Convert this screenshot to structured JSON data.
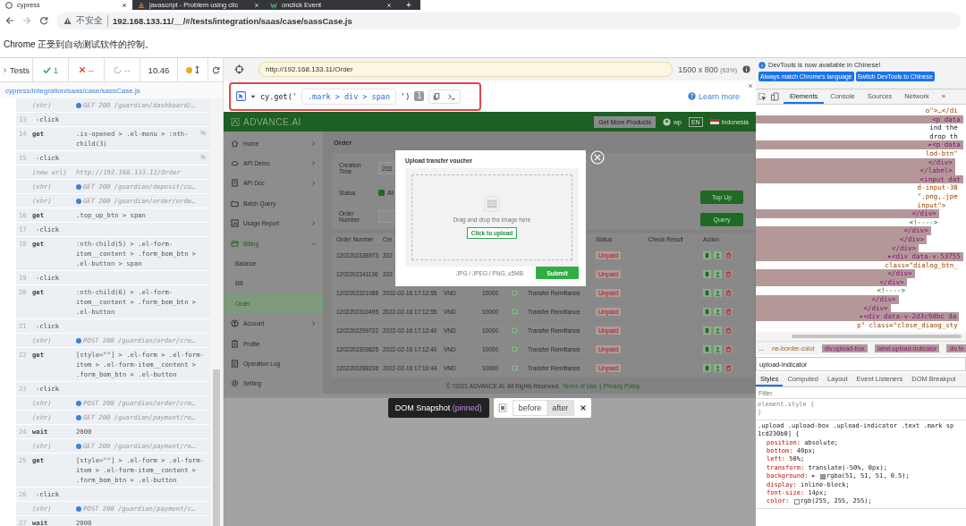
{
  "browser_tabs": [
    {
      "title": "cypress",
      "selected": true
    },
    {
      "title": "javascript - Problem using clic",
      "selected": false
    },
    {
      "title": "onclick Event",
      "selected": false
    }
  ],
  "new_tab": "+",
  "address_bar": {
    "security": "不安全",
    "url": "192.168.133.11/__/#/tests/integration/saas/case/sassCase.js"
  },
  "automation_notice": "Chrome 正受到自动测试软件的控制。",
  "runner": {
    "tests_label": "Tests",
    "passed": "1",
    "failed": "--",
    "pending": "--",
    "duration": "10.46",
    "spec_path": "cypress/integration/saas/case/sassCase.js",
    "log": [
      {
        "kind": "xhr",
        "label": "(xhr)",
        "text": "GET 200 /guardian/dashboard/…"
      },
      {
        "kind": "command",
        "number": "13",
        "name": "-click",
        "hidden": false
      },
      {
        "kind": "command",
        "number": "14",
        "name": "get",
        "message": ".is-opened > .el-menu > :nth-child(3)",
        "hidden": true
      },
      {
        "kind": "command",
        "number": "15",
        "name": "-click",
        "hidden": true
      },
      {
        "kind": "url",
        "label": "(new url)",
        "text": "http://192.168.133.11/Order"
      },
      {
        "kind": "xhr",
        "label": "(xhr)",
        "text": "GET 200 /guardian/deposit/cu…"
      },
      {
        "kind": "xhr",
        "label": "(xhr)",
        "text": "GET 200 /guardian/order/orde…"
      },
      {
        "kind": "command",
        "number": "16",
        "name": "get",
        "message": ".top_up_btn > span",
        "hidden": false
      },
      {
        "kind": "command",
        "number": "17",
        "name": "-click",
        "hidden": false
      },
      {
        "kind": "command",
        "number": "18",
        "name": "get",
        "message": ":nth-child(5) > .el-form-item__content > .form_bom_btn > .el-button > span",
        "hidden": false
      },
      {
        "kind": "command",
        "number": "19",
        "name": "-click",
        "hidden": false
      },
      {
        "kind": "command",
        "number": "20",
        "name": "get",
        "message": ":nth-child(6) > .el-form-item__content > .form_bom_btn > .el-button",
        "hidden": false
      },
      {
        "kind": "command",
        "number": "21",
        "name": "-click",
        "hidden": false
      },
      {
        "kind": "xhr",
        "label": "(xhr)",
        "text": "POST 200 /guardian/order/cre…"
      },
      {
        "kind": "command",
        "number": "22",
        "name": "get",
        "message": "[style=\"\"] > .el-form > .el-form-item > .el-form-item__content > .form_bom_btn > .el-button",
        "hidden": false
      },
      {
        "kind": "command",
        "number": "23",
        "name": "-click",
        "hidden": false
      },
      {
        "kind": "xhr",
        "label": "(xhr)",
        "text": "POST 200 /guardian/order/cre…"
      },
      {
        "kind": "xhr",
        "label": "(xhr)",
        "text": "GET 200 /guardian/payment/re…"
      },
      {
        "kind": "command",
        "number": "24",
        "name": "wait",
        "message": "2000",
        "hidden": false
      },
      {
        "kind": "xhr",
        "label": "(xhr)",
        "text": "GET 200 /guardian/payment/re…"
      },
      {
        "kind": "command",
        "number": "25",
        "name": "get",
        "message": "[style=\"\"] > .el-form > .el-form-item > .el-form-item__content > .form_bom_btn > .el-button",
        "hidden": false
      },
      {
        "kind": "command",
        "number": "26",
        "name": "-click",
        "hidden": false
      },
      {
        "kind": "xhr",
        "label": "(xhr)",
        "text": "POST 200 /guardian/payment/c…"
      },
      {
        "kind": "command",
        "number": "27",
        "name": "wait",
        "message": "2000",
        "hidden": false
      }
    ]
  },
  "preview": {
    "url": "http://192.168.133.11/Order",
    "viewport": "1500 x 800",
    "scale": "(63%)",
    "selector": {
      "prefix": "cy.get('",
      "value": ".mark > div > span",
      "suffix": "')",
      "matches": "1"
    },
    "learn_more": "Learn more"
  },
  "app": {
    "logo": "ADVANCE.AI",
    "header_button": "Get More Products",
    "user": "wp",
    "language": "EN",
    "region": "Indonesia",
    "sidebar": [
      {
        "kind": "group",
        "label": "Home",
        "expanded": false
      },
      {
        "kind": "group",
        "label": "API Demo",
        "expanded": false
      },
      {
        "kind": "group",
        "label": "API Doc",
        "expanded": false
      },
      {
        "kind": "link",
        "label": "Batch Query",
        "selected": false
      },
      {
        "kind": "group",
        "label": "Usage Report",
        "expanded": false
      },
      {
        "kind": "group",
        "label": "Billing",
        "expanded": true,
        "children": [
          {
            "label": "Balance",
            "selected": false
          },
          {
            "label": "Bill",
            "selected": false
          },
          {
            "label": "Order",
            "selected": true
          }
        ]
      },
      {
        "kind": "group",
        "label": "Account",
        "expanded": false
      },
      {
        "kind": "link",
        "label": "Profile",
        "selected": false
      },
      {
        "kind": "link",
        "label": "Operation Log",
        "selected": false
      },
      {
        "kind": "link",
        "label": "Setting",
        "selected": false
      }
    ],
    "page_title": "Order",
    "filters": {
      "creation_time_label": "Creation Time",
      "creation_time_value": "202",
      "status_label": "Status",
      "status_option": {
        "label": "All",
        "checked": true
      },
      "order_number_label": "Order Number"
    },
    "buttons": [
      "Top Up",
      "Query"
    ],
    "table": {
      "columns": [
        "Order Number",
        "Cre",
        "Status",
        "Check Result",
        "Action"
      ],
      "rows": [
        {
          "order_number": "1202202338973",
          "created": "202",
          "status": "Unpaid"
        },
        {
          "order_number": "1202202341136",
          "created": "202",
          "status": "Unpaid"
        },
        {
          "order_number": "1202202321088",
          "created": "2022-02-16 17:12:55",
          "currency": "VND",
          "amount": "10000",
          "method": "Transfer Remittance",
          "status": "Unpaid"
        },
        {
          "order_number": "1202202310495",
          "created": "2022-02-16 17:12:55",
          "currency": "VND",
          "amount": "10000",
          "method": "Transfer Remittance",
          "status": "Unpaid"
        },
        {
          "order_number": "1202202299722",
          "created": "2022-02-16 17:12:40",
          "currency": "VND",
          "amount": "10000",
          "method": "Transfer Remittance",
          "status": "Unpaid"
        },
        {
          "order_number": "1202202303825",
          "created": "2022-02-16 17:12:40",
          "currency": "VND",
          "amount": "10000",
          "method": "Transfer Remittance",
          "status": "Unpaid"
        },
        {
          "order_number": "1202202288236",
          "created": "2022-02-16 17:10:44",
          "currency": "VND",
          "amount": "10000",
          "method": "Transfer Remittance",
          "status": "Unpaid"
        }
      ]
    },
    "footer": {
      "text": "© ?2021 ADVANCE.AI. All Rights Reserved.",
      "links": [
        "Terms of Use",
        "Privacy Policy"
      ],
      "separator": "|"
    },
    "dialog": {
      "title": "Upload transfer voucher",
      "hint": "Drag and drop the image here",
      "upload_button": "Click to upload",
      "formats": "JPG / JPEG / PNG, ≤5MB",
      "submit": "Submit"
    }
  },
  "snapshot_bar": {
    "label": "DOM Snapshot",
    "note": "(pinned)",
    "states": [
      {
        "label": "before",
        "selected": false
      },
      {
        "label": "after",
        "selected": true
      }
    ]
  },
  "devtools": {
    "notice": "DevTools is now available in Chinese!",
    "notice_buttons": [
      "Always match Chrome's language",
      "Switch DevTools to Chinese"
    ],
    "tabs": [
      {
        "label": "Elements",
        "selected": true
      },
      {
        "label": "Console",
        "selected": false
      },
      {
        "label": "Sources",
        "selected": false
      },
      {
        "label": "Network",
        "selected": false
      }
    ],
    "more": "»",
    "dom_lines": [
      {
        "kind": "attr",
        "text": "                                          o\">…</di"
      },
      {
        "kind": "tag",
        "text": "                                           <p data"
      },
      {
        "kind": "text",
        "text": "                                           ind the"
      },
      {
        "kind": "text",
        "text": "                                           drop th"
      },
      {
        "kind": "tag",
        "text": "                                          ▸<p data"
      },
      {
        "kind": "attr",
        "text": "                                          lod-btn\""
      },
      {
        "kind": "tag",
        "text": "                                          </div>"
      },
      {
        "kind": "tag",
        "text": "                                        </label>"
      },
      {
        "kind": "tag",
        "text": "                                        <input dat"
      },
      {
        "kind": "attr",
        "text": "                                        d-input-38"
      },
      {
        "kind": "attr",
        "text": "                                        \".png,.jpe"
      },
      {
        "kind": "attr",
        "text": "                                        input\">"
      },
      {
        "kind": "tag",
        "text": "                                      </div>"
      },
      {
        "kind": "comment",
        "text": "                                      <!---->"
      },
      {
        "kind": "tag",
        "text": "                                    </div>"
      },
      {
        "kind": "tag",
        "text": "                                   </div>"
      },
      {
        "kind": "tag",
        "text": "                                 </div>"
      },
      {
        "kind": "tag",
        "text": "                                ▸<div data-v-53755"
      },
      {
        "kind": "attr",
        "text": "                                class=\"dialog_btn_"
      },
      {
        "kind": "tag",
        "text": "                                </div>"
      },
      {
        "kind": "tag",
        "text": "                              </div>"
      },
      {
        "kind": "comment",
        "text": "                              <!---->"
      },
      {
        "kind": "tag",
        "text": "                            </div>"
      },
      {
        "kind": "tag",
        "text": "                          </div>"
      },
      {
        "kind": "tag",
        "text": "                         ▸<div data-v-2d3c9dbc da"
      },
      {
        "kind": "attr",
        "text": "                         p\" class=\"close_diaog_sty"
      }
    ],
    "breadcrumb_more": "…",
    "breadcrumbs": [
      {
        "kind": "attr",
        "text": "ne-border-color"
      },
      {
        "kind": "tag",
        "text": "div.upload-box"
      },
      {
        "kind": "tag",
        "text": "label.upload-indicator"
      },
      {
        "kind": "tag",
        "text": "div.te"
      }
    ],
    "search_value": "upload-indicator",
    "style_tabs": [
      {
        "label": "Styles",
        "selected": true
      },
      {
        "label": "Computed",
        "selected": false
      },
      {
        "label": "Layout",
        "selected": false
      },
      {
        "label": "Event Listeners",
        "selected": false
      },
      {
        "label": "DOM Breakpoi",
        "selected": false
      }
    ],
    "filter_placeholder": "Filter",
    "rules": [
      {
        "selector_lines": [
          "element.style {"
        ],
        "closing": "}"
      },
      {
        "selector_lines": [
          ".upload .upload-box .upload-indicator .text .mark sp",
          "1cd230b0] {"
        ],
        "properties": [
          {
            "name": "position:",
            "value": "absolute;"
          },
          {
            "name": "bottom:",
            "value": "40px;"
          },
          {
            "name": "left:",
            "value": "50%;"
          },
          {
            "name": "transform:",
            "value": "translate(-50%, 0px);"
          },
          {
            "name": "background:",
            "expander": "▸",
            "color": "#999999",
            "value": "rgba(51, 51, 51, 0.5);"
          },
          {
            "name": "display:",
            "value": "inline-block;"
          },
          {
            "name": "font-size:",
            "value": "14px;"
          },
          {
            "name": "color:",
            "color": "#ffffff",
            "value": "rgb(255, 255, 255);"
          }
        ]
      }
    ]
  }
}
